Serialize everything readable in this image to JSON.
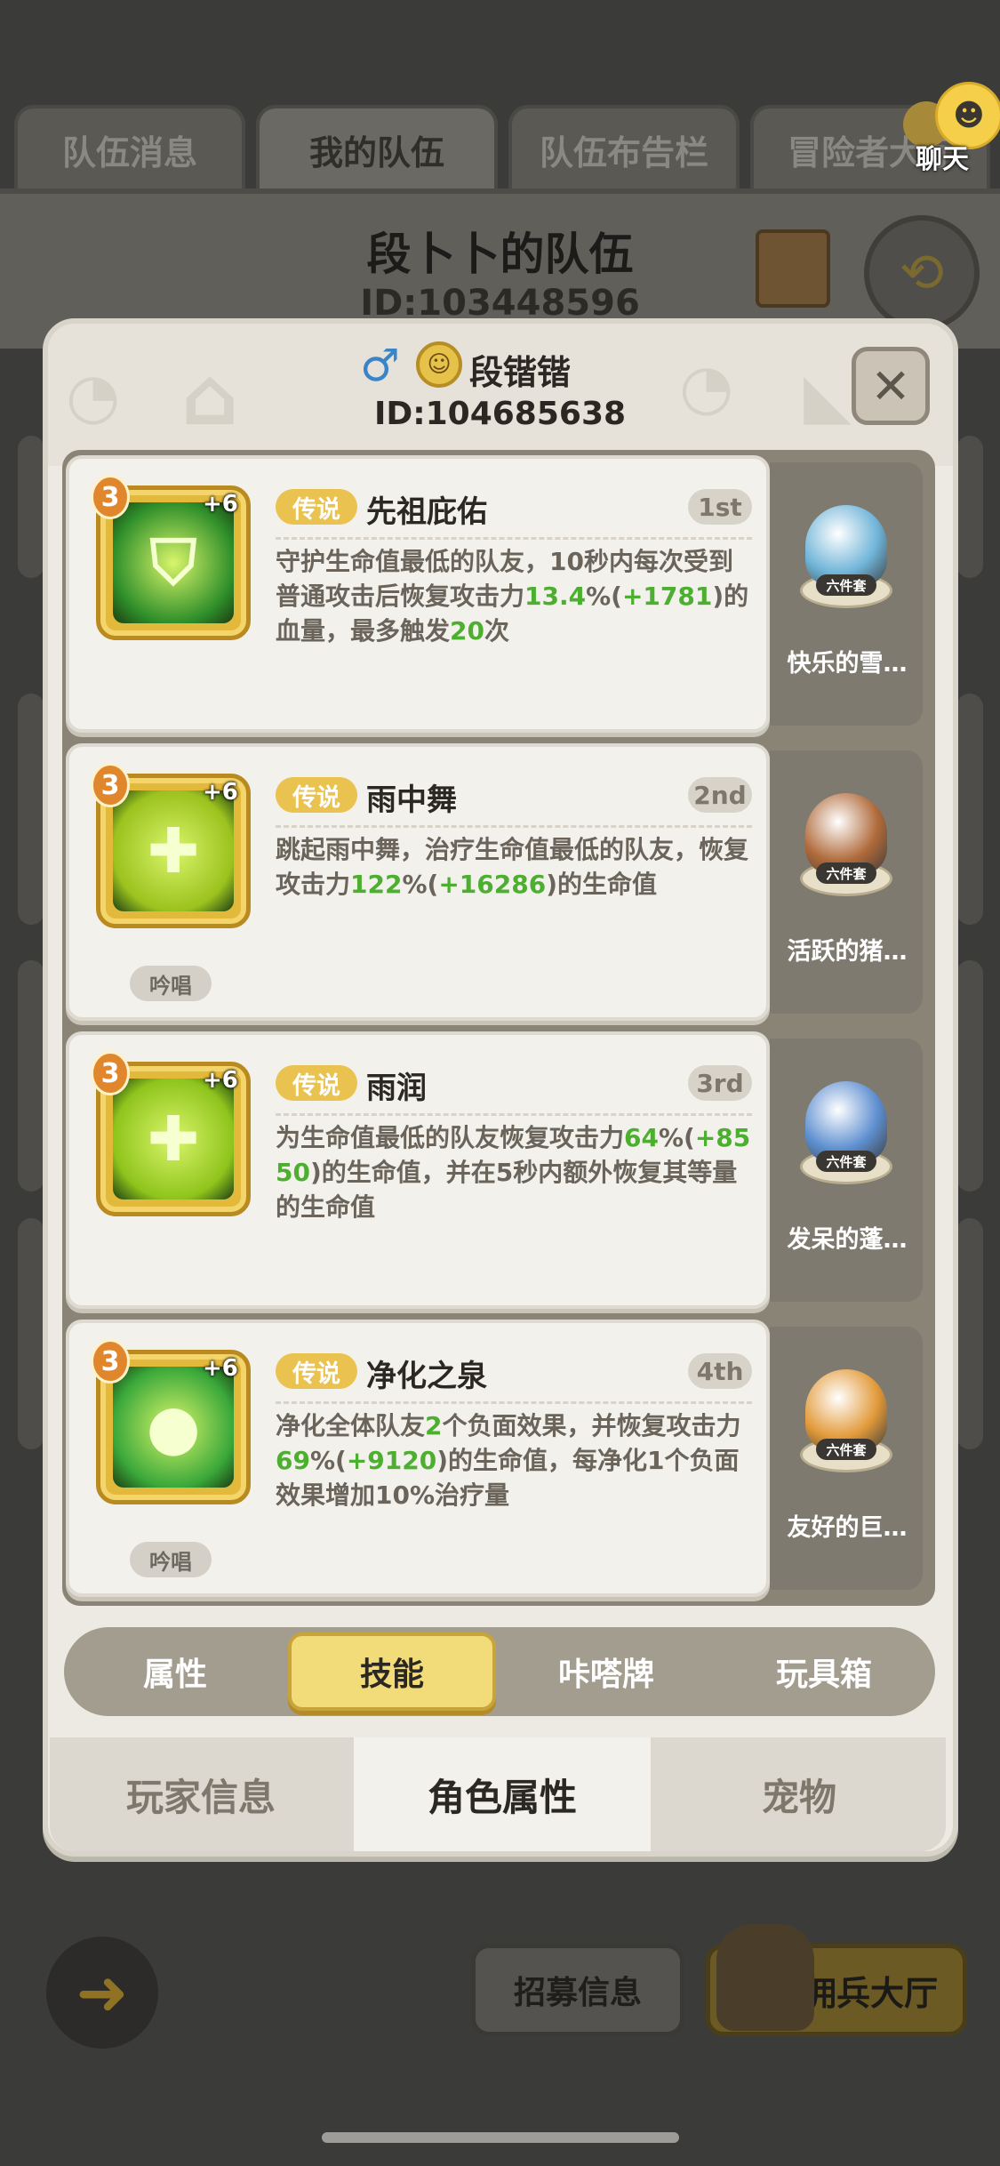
{
  "background": {
    "tabs": [
      {
        "label": "队伍消息"
      },
      {
        "label": "我的队伍"
      },
      {
        "label": "队伍布告栏"
      },
      {
        "label": "冒险者大厅"
      }
    ],
    "team_title": "段卜卜的队伍",
    "team_id": "ID:103448596",
    "chat_label": "聊天",
    "recruit_label": "招募信息",
    "mercenary_label": "佣兵大厅"
  },
  "profile": {
    "name": "段锴锴",
    "id": "ID:104685638",
    "gender_icon": "male-icon",
    "close_icon": "close-icon"
  },
  "skills": [
    {
      "rarity": "传说",
      "name": "先祖庇佑",
      "rank": "1st",
      "level": "3",
      "plus": "+6",
      "icon": "shield-icon",
      "color": "#2f8f2a",
      "chant": "",
      "desc_parts": [
        {
          "t": "守护生命值最低的队友，10秒内每次受到普通攻击后恢复攻击力",
          "h": false
        },
        {
          "t": "13.4",
          "h": true
        },
        {
          "t": "%(",
          "h": false
        },
        {
          "t": "+1781",
          "h": true
        },
        {
          "t": ")的血量，最多触发",
          "h": false
        },
        {
          "t": "20",
          "h": true
        },
        {
          "t": "次",
          "h": false
        }
      ]
    },
    {
      "rarity": "传说",
      "name": "雨中舞",
      "rank": "2nd",
      "level": "3",
      "plus": "+6",
      "icon": "rain-dance-icon",
      "color": "#9bc21e",
      "chant": "吟唱",
      "desc_parts": [
        {
          "t": "跳起雨中舞，治疗生命值最低的队友，恢复攻击力",
          "h": false
        },
        {
          "t": "122",
          "h": true
        },
        {
          "t": "%(",
          "h": false
        },
        {
          "t": "+16286",
          "h": true
        },
        {
          "t": ")的生命值",
          "h": false
        }
      ]
    },
    {
      "rarity": "传说",
      "name": "雨润",
      "rank": "3rd",
      "level": "3",
      "plus": "+6",
      "icon": "heal-cross-icon",
      "color": "#8fc41c",
      "chant": "",
      "desc_parts": [
        {
          "t": "为生命值最低的队友恢复攻击力",
          "h": false
        },
        {
          "t": "64",
          "h": true
        },
        {
          "t": "%(",
          "h": false
        },
        {
          "t": "+8550",
          "h": true
        },
        {
          "t": ")的生命值，并在5秒内额外恢复其等量的生命值",
          "h": false
        }
      ]
    },
    {
      "rarity": "传说",
      "name": "净化之泉",
      "rank": "4th",
      "level": "3",
      "plus": "+6",
      "icon": "droplet-icon",
      "color": "#3aa83a",
      "chant": "吟唱",
      "desc_parts": [
        {
          "t": "净化全体队友",
          "h": false
        },
        {
          "t": "2",
          "h": true
        },
        {
          "t": "个负面效果，并恢复攻击力",
          "h": false
        },
        {
          "t": "69",
          "h": true
        },
        {
          "t": "%(",
          "h": false
        },
        {
          "t": "+9120",
          "h": true
        },
        {
          "t": ")的生命值，每净化1个负面效果增加10%治疗量",
          "h": false
        }
      ]
    }
  ],
  "pets": [
    {
      "name": "快乐的雪…",
      "set": "六件套",
      "color": "#6fb4d8"
    },
    {
      "name": "活跃的猪…",
      "set": "六件套",
      "color": "#b06a3a"
    },
    {
      "name": "发呆的蓬…",
      "set": "六件套",
      "color": "#5e8fd0"
    },
    {
      "name": "友好的巨…",
      "set": "六件套",
      "color": "#e29a3a"
    }
  ],
  "sub_tabs": [
    {
      "label": "属性",
      "active": false
    },
    {
      "label": "技能",
      "active": true
    },
    {
      "label": "咔嗒牌",
      "active": false
    },
    {
      "label": "玩具箱",
      "active": false
    }
  ],
  "bottom_tabs": [
    {
      "label": "玩家信息",
      "active": false
    },
    {
      "label": "角色属性",
      "active": true
    },
    {
      "label": "宠物",
      "active": false
    }
  ]
}
